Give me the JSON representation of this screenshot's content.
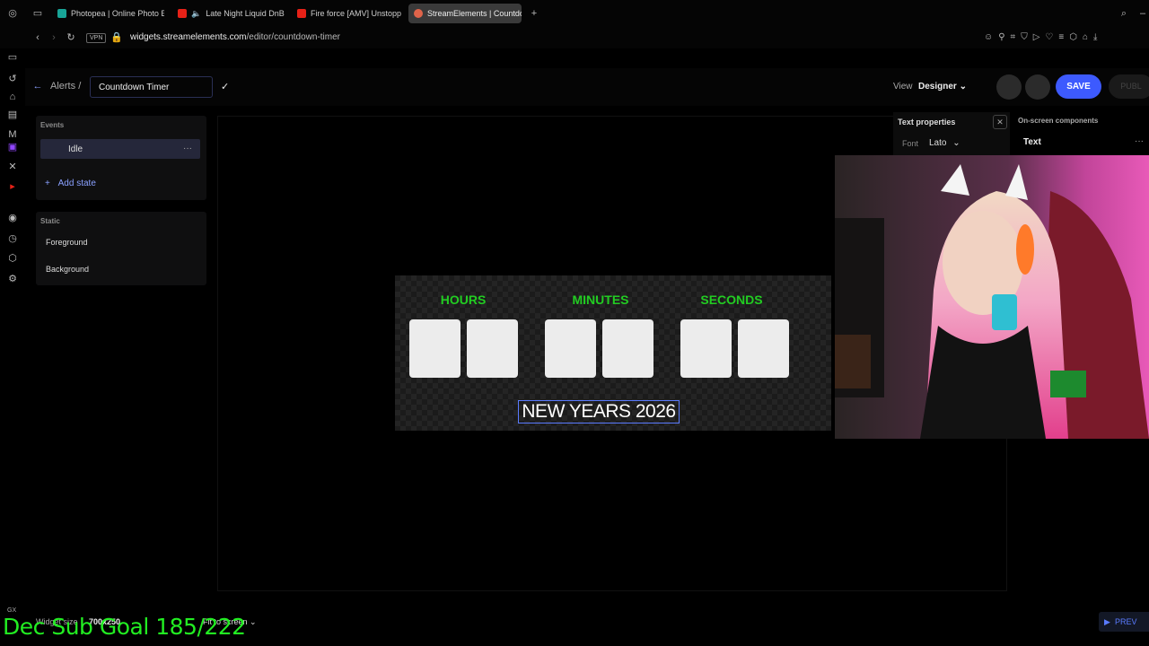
{
  "browser": {
    "tabs": [
      {
        "label": "Photopea | Online Photo E",
        "color": "#18a497"
      },
      {
        "label": "Late Night Liquid DnB",
        "color": "#e62117"
      },
      {
        "label": "Fire force [AMV] Unstopp",
        "color": "#e62117"
      },
      {
        "label": "StreamElements | Countdo",
        "color": "#e0644a"
      }
    ],
    "new_tab": "+",
    "url_domain": "widgets.streamelements.com",
    "url_path": "/editor/countdown-timer",
    "vpn_badge": "VPN"
  },
  "editor": {
    "breadcrumb": "Alerts",
    "breadcrumb_sep": "/",
    "widget_name": "Countdown Timer",
    "view_label": "View",
    "view_value": "Designer",
    "save_label": "SAVE",
    "publish_label": "PUBL"
  },
  "left_panel": {
    "events_label": "Events",
    "idle_label": "Idle",
    "add_state_label": "Add state",
    "static_label": "Static",
    "foreground_label": "Foreground",
    "background_label": "Background"
  },
  "widget": {
    "hours_label": "HOURS",
    "minutes_label": "MINUTES",
    "seconds_label": "SECONDS",
    "title_text": "NEW YEARS 2026",
    "accent_color": "#22cc22"
  },
  "right_panel": {
    "text_properties_title": "Text properties",
    "font_label": "Font",
    "font_value": "Lato",
    "onscreen_title": "On-screen components",
    "onscreen_item": "Text"
  },
  "footer": {
    "widget_size_label": "Widget size",
    "widget_size_value": "700x250",
    "fit_label": "Fit to screen",
    "preview_label": "PREV",
    "overlay_text": "Dec Sub Goal 185/222"
  }
}
